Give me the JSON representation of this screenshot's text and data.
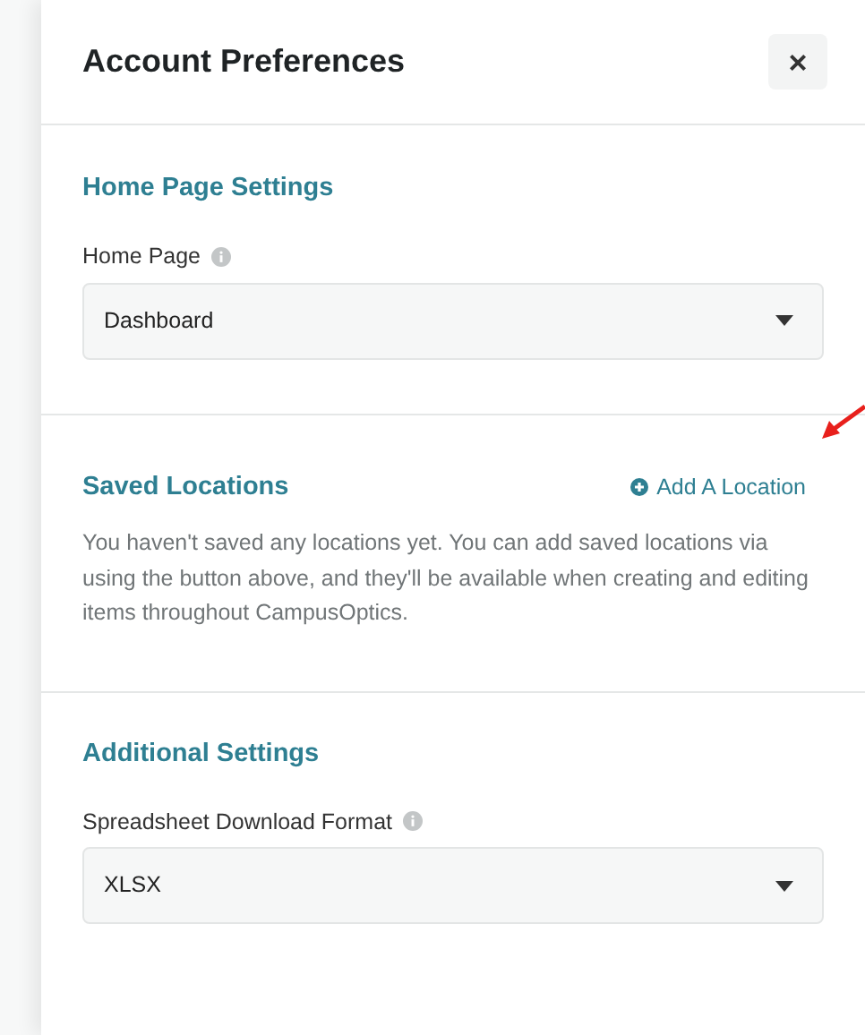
{
  "panel": {
    "title": "Account Preferences",
    "close": "×"
  },
  "sections": [
    {
      "kind": "select",
      "heading": "Home Page Settings",
      "label": "Home Page",
      "value": "Dashboard"
    },
    {
      "kind": "info",
      "heading": "Saved Locations",
      "action": "Add A Location",
      "text": "You haven't saved any locations yet. You can add saved locations via using the button above, and they'll be available when creating and editing items throughout CampusOptics."
    },
    {
      "kind": "select",
      "heading": "Additional Settings",
      "label": "Spreadsheet Download Format",
      "value": "XLSX"
    }
  ]
}
